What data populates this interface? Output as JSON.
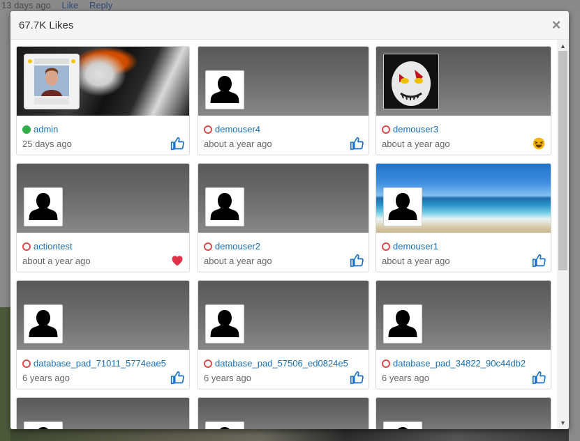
{
  "background": {
    "top_text": "13 days ago",
    "like_link": "Like",
    "reply_link": "Reply"
  },
  "modal": {
    "title": "67.7K Likes",
    "close_label": "×"
  },
  "likes": [
    {
      "username": "admin",
      "time": "25 days ago",
      "online": true,
      "reaction": "like-icon",
      "cover": "anime",
      "avatar": "photo"
    },
    {
      "username": "demouser4",
      "time": "about a year ago",
      "online": false,
      "reaction": "like-icon",
      "cover": "default",
      "avatar": "default"
    },
    {
      "username": "demouser3",
      "time": "about a year ago",
      "online": false,
      "reaction": "laugh-icon",
      "cover": "default",
      "avatar": "mask"
    },
    {
      "username": "actiontest",
      "time": "about a year ago",
      "online": false,
      "reaction": "heart-icon",
      "cover": "default",
      "avatar": "default"
    },
    {
      "username": "demouser2",
      "time": "about a year ago",
      "online": false,
      "reaction": "like-icon",
      "cover": "default",
      "avatar": "default"
    },
    {
      "username": "demouser1",
      "time": "about a year ago",
      "online": false,
      "reaction": "like-icon",
      "cover": "beach",
      "avatar": "default"
    },
    {
      "username": "database_pad_71011_5774eae5",
      "time": "6 years ago",
      "online": false,
      "reaction": "like-icon",
      "cover": "default",
      "avatar": "default"
    },
    {
      "username": "database_pad_57506_ed0824e5",
      "time": "6 years ago",
      "online": false,
      "reaction": "like-icon",
      "cover": "default",
      "avatar": "default"
    },
    {
      "username": "database_pad_34822_90c44db2",
      "time": "6 years ago",
      "online": false,
      "reaction": "like-icon",
      "cover": "default",
      "avatar": "default"
    }
  ],
  "colors": {
    "link": "#1a6fb5",
    "online": "#2fae4a",
    "offline": "#e04a4a",
    "like": "#1a73c9",
    "heart": "#e0334a",
    "laugh": "#f5b50a"
  }
}
